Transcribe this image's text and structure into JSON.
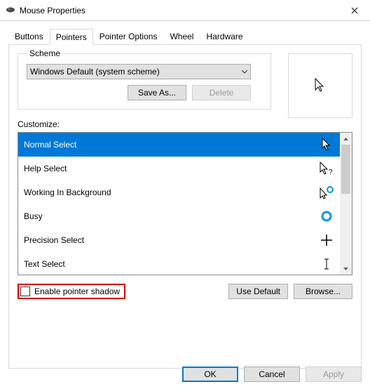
{
  "window": {
    "title": "Mouse Properties"
  },
  "tabs": {
    "buttons": "Buttons",
    "pointers": "Pointers",
    "pointer_options": "Pointer Options",
    "wheel": "Wheel",
    "hardware": "Hardware"
  },
  "scheme": {
    "legend": "Scheme",
    "selected": "Windows Default (system scheme)",
    "save_as": "Save As...",
    "delete": "Delete"
  },
  "customize": {
    "label": "Customize:",
    "items": [
      {
        "label": "Normal Select",
        "icon": "cursor-arrow-white",
        "selected": true
      },
      {
        "label": "Help Select",
        "icon": "cursor-help"
      },
      {
        "label": "Working In Background",
        "icon": "cursor-working"
      },
      {
        "label": "Busy",
        "icon": "cursor-busy"
      },
      {
        "label": "Precision Select",
        "icon": "cursor-precision"
      },
      {
        "label": "Text Select",
        "icon": "cursor-text"
      }
    ]
  },
  "shadow": {
    "label": "Enable pointer shadow",
    "checked": false
  },
  "use_default": "Use Default",
  "browse": "Browse...",
  "footer": {
    "ok": "OK",
    "cancel": "Cancel",
    "apply": "Apply"
  }
}
